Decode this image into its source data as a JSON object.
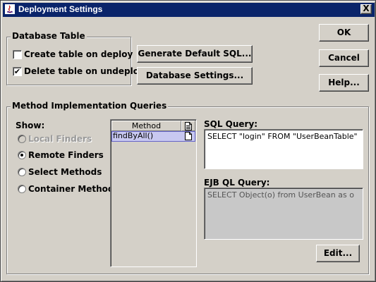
{
  "window": {
    "title": "Deployment Settings",
    "close_label": "X"
  },
  "database_table": {
    "title": "Database Table",
    "create_table_label": "Create table on deploy",
    "create_table_checked": false,
    "delete_table_label": "Delete table on undeploy",
    "delete_table_checked": true,
    "check_mark": "✔"
  },
  "buttons": {
    "generate_sql": "Generate Default SQL...",
    "database_settings": "Database Settings...",
    "ok": "OK",
    "cancel": "Cancel",
    "help": "Help...",
    "edit": "Edit..."
  },
  "method_queries": {
    "title": "Method Implementation Queries",
    "show_label": "Show:",
    "options": [
      {
        "label": "Local Finders",
        "selected": false,
        "enabled": false
      },
      {
        "label": "Remote Finders",
        "selected": true,
        "enabled": true
      },
      {
        "label": "Select Methods",
        "selected": false,
        "enabled": true
      },
      {
        "label": "Container Methods",
        "selected": false,
        "enabled": true
      }
    ],
    "table": {
      "column_header": "Method",
      "header_icon": "document-icon",
      "rows": [
        {
          "method": "findByAll()",
          "row_icon": "document-icon"
        }
      ]
    },
    "sql_query_label": "SQL Query:",
    "sql_query_value": "SELECT \"login\" FROM \"UserBeanTable\"",
    "ejb_ql_label": "EJB QL Query:",
    "ejb_ql_value": "SELECT Object(o) from UserBean as o"
  },
  "colors": {
    "title_bar": "#0a246a",
    "face": "#d4d0c8",
    "selection": "#c8c8f0",
    "disabled_text": "#9a9a9a"
  }
}
